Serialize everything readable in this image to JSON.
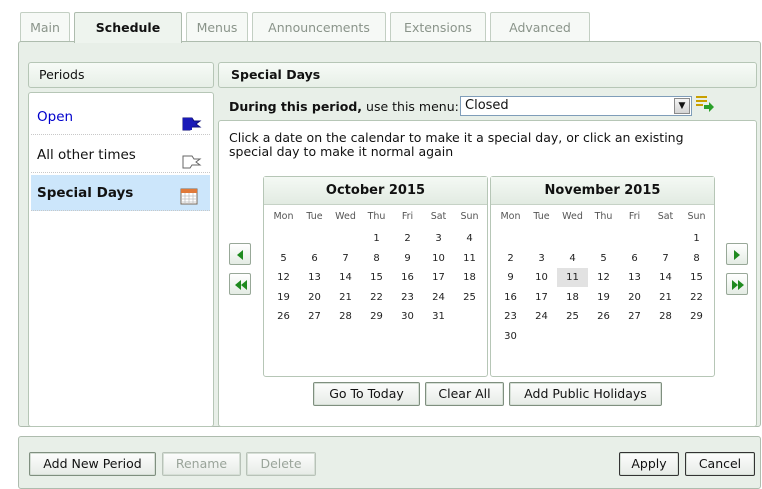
{
  "tabs": [
    {
      "label": "Main",
      "active": false
    },
    {
      "label": "Schedule",
      "active": true
    },
    {
      "label": "Menus",
      "active": false
    },
    {
      "label": "Announcements",
      "active": false
    },
    {
      "label": "Extensions",
      "active": false
    },
    {
      "label": "Advanced",
      "active": false
    }
  ],
  "periods": {
    "title": "Periods",
    "items": [
      {
        "label": "Open",
        "color": "#0000cc",
        "icon": "blue-flag-icon"
      },
      {
        "label": "All other times",
        "color": "#111111",
        "icon": "white-flag-icon"
      },
      {
        "label": "Special Days",
        "color": "#111111",
        "icon": "calendar-icon",
        "selected": true
      }
    ]
  },
  "special_days": {
    "title": "Special Days",
    "menu_prefix_bold": "During this period,",
    "menu_prefix_rest": " use this menu:",
    "menu_value": "Closed",
    "instruction_line1": "Click a date on the calendar to make it a special day, or click an existing",
    "instruction_line2": "special day to make it normal again"
  },
  "calendar": {
    "weekdays": [
      "Mon",
      "Tue",
      "Wed",
      "Thu",
      "Fri",
      "Sat",
      "Sun"
    ],
    "months": [
      {
        "title": "October 2015",
        "weeks": [
          [
            "",
            "",
            "",
            "1",
            "2",
            "3",
            "4"
          ],
          [
            "5",
            "6",
            "7",
            "8",
            "9",
            "10",
            "11"
          ],
          [
            "12",
            "13",
            "14",
            "15",
            "16",
            "17",
            "18"
          ],
          [
            "19",
            "20",
            "21",
            "22",
            "23",
            "24",
            "25"
          ],
          [
            "26",
            "27",
            "28",
            "29",
            "30",
            "31",
            ""
          ]
        ]
      },
      {
        "title": "November 2015",
        "weeks": [
          [
            "",
            "",
            "",
            "",
            "",
            "",
            "1"
          ],
          [
            "2",
            "3",
            "4",
            "5",
            "6",
            "7",
            "8"
          ],
          [
            "9",
            "10",
            "11",
            "12",
            "13",
            "14",
            "15"
          ],
          [
            "16",
            "17",
            "18",
            "19",
            "20",
            "21",
            "22"
          ],
          [
            "23",
            "24",
            "25",
            "26",
            "27",
            "28",
            "29"
          ],
          [
            "30",
            "",
            "",
            "",
            "",
            "",
            ""
          ]
        ],
        "today": "11"
      }
    ]
  },
  "calendar_actions": {
    "go_to_today": "Go To Today",
    "clear_all": "Clear All",
    "add_public_holidays": "Add Public Holidays"
  },
  "footer": {
    "add_new_period": "Add New Period",
    "rename": "Rename",
    "delete": "Delete",
    "apply": "Apply",
    "cancel": "Cancel"
  },
  "colors": {
    "accent_green": "#1f8a1f",
    "link_blue": "#0000cc",
    "selected_row": "#cce6fb"
  }
}
